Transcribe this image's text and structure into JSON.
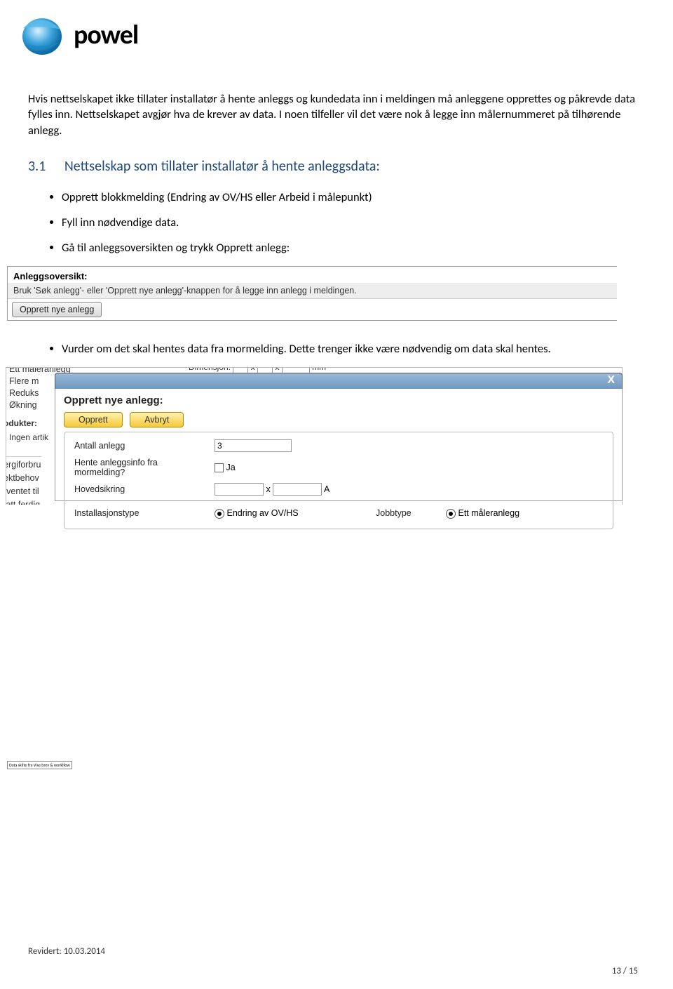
{
  "header": {
    "brand": "powel"
  },
  "body": {
    "p1": "Hvis nettselskapet ikke tillater installatør å hente anleggs og kundedata inn i meldingen må anleggene opprettes og påkrevde data fylles inn. Nettselskapet avgjør hva de krever av data. I noen tilfeller vil det være nok å legge inn målernummeret på tilhørende anlegg.",
    "section_num": "3.1",
    "section_title": "Nettselskap som tillater installatør å hente anleggsdata:",
    "b1": "Opprett blokkmelding (Endring av OV/HS eller Arbeid i målepunkt)",
    "b2": "Fyll inn nødvendige data.",
    "b3": "Gå til anleggsoversikten og trykk Opprett anlegg:",
    "b4": "Vurder om det skal hentes data fra mormelding. Dette trenger ikke være nødvendig om data skal hentes."
  },
  "shot1": {
    "title": "Anleggsoversikt:",
    "hint": "Bruk 'Søk anlegg'- eller 'Opprett nye anlegg'-knappen for å legge inn anlegg i meldingen.",
    "button": "Opprett nye anlegg"
  },
  "shot2": {
    "bg": {
      "l1": "Ett måleranlegg",
      "l2": "Flere m",
      "l3": "Reduks",
      "l4": "Økning",
      "l5": "odukter:",
      "l6": "Ingen artik",
      "l7": "ergiforbru",
      "l8": "ektbehov",
      "l9": "rventet til",
      "l10": "tatt ferdig",
      "dim": "Dimensjon:",
      "dim2": "x",
      "dim3": "x",
      "dim4": "mm"
    },
    "modal": {
      "close": "X",
      "title": "Opprett nye anlegg:",
      "btn_opprett": "Opprett",
      "btn_avbryt": "Avbryt",
      "row_antall": "Antall anlegg",
      "val_antall": "3",
      "row_hente": "Hente anleggsinfo fra mormelding?",
      "lbl_ja": "Ja",
      "row_hoved": "Hovedsikring",
      "lbl_x": "x",
      "lbl_A": "A",
      "row_insttype": "Installasjonstype",
      "opt_insttype": "Endring av OV/HS",
      "row_jobbtype": "Jobbtype",
      "opt_jobbtype": "Ett måleranlegg"
    }
  },
  "tiny": "Data skilte fra Vise brev & worklfow",
  "footer": {
    "revised": "Revidert: 10.03.2014",
    "pager": "13 / 15"
  }
}
